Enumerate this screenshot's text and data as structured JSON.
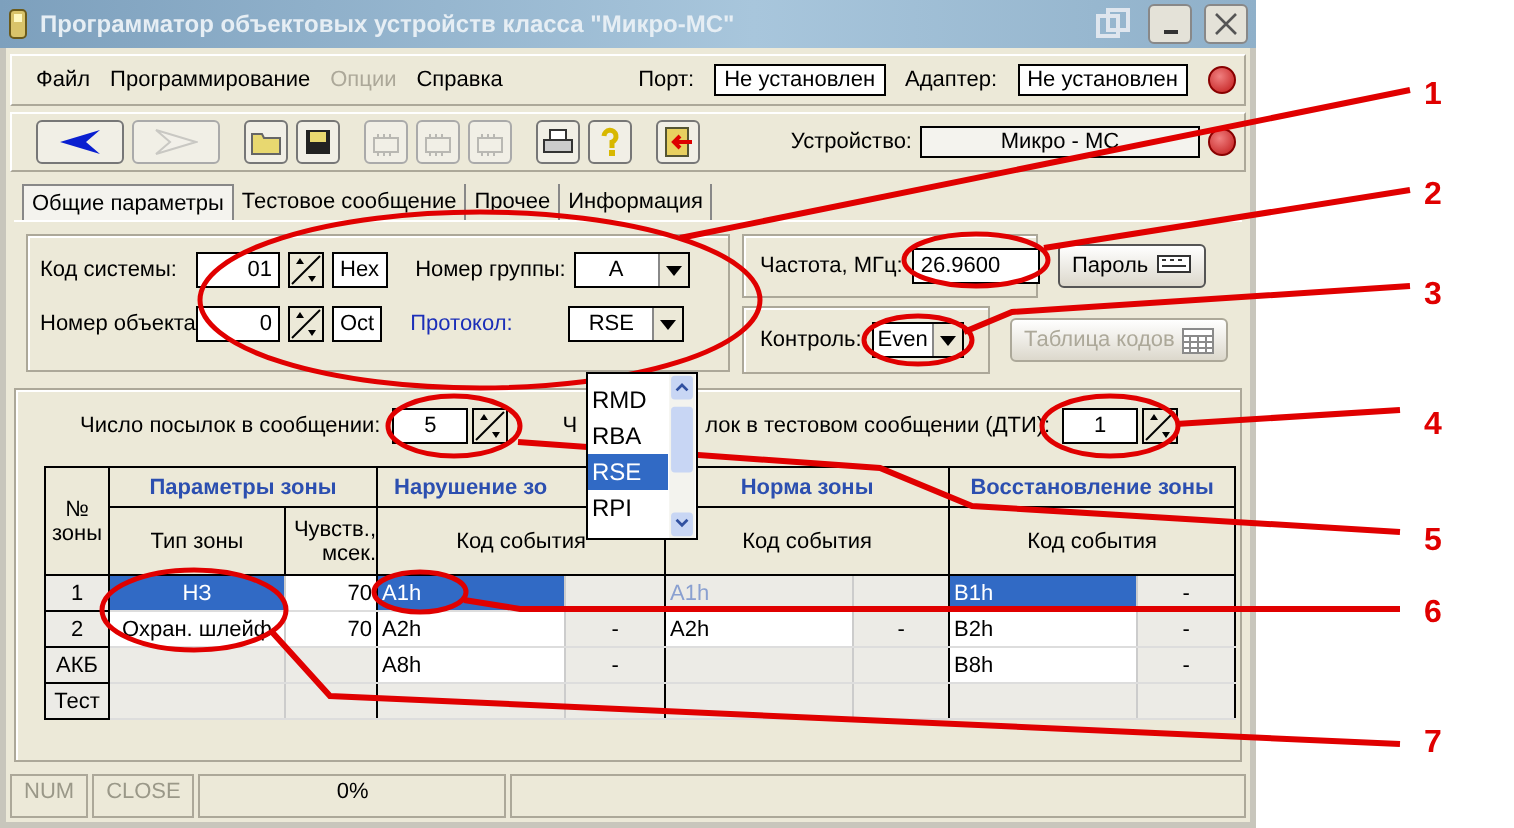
{
  "window": {
    "title": "Программатор объектовых устройств класса \"Микро-МС\""
  },
  "menu": [
    {
      "label": "Файл",
      "disabled": false
    },
    {
      "label": "Программирование",
      "disabled": false
    },
    {
      "label": "Опции",
      "disabled": true
    },
    {
      "label": "Справка",
      "disabled": false
    }
  ],
  "port": {
    "label": "Порт:",
    "value": "Не установлен"
  },
  "adapter": {
    "label": "Адаптер:",
    "value": "Не установлен"
  },
  "toolbar": [
    {
      "kind": "back",
      "disabled": false
    },
    {
      "kind": "forward",
      "disabled": true
    },
    {
      "kind": "open",
      "disabled": false
    },
    {
      "kind": "save",
      "disabled": false
    },
    {
      "kind": "read",
      "disabled": true
    },
    {
      "kind": "write",
      "disabled": true
    },
    {
      "kind": "clear",
      "disabled": true
    },
    {
      "kind": "print",
      "disabled": false
    },
    {
      "kind": "help",
      "disabled": false
    },
    {
      "kind": "exit",
      "disabled": false
    }
  ],
  "device": {
    "label": "Устройство:",
    "value": "Микро - МС"
  },
  "tabs": [
    {
      "label": "Общие  параметры",
      "selected": true
    },
    {
      "label": "Тестовое сообщение",
      "selected": false
    },
    {
      "label": "Прочее",
      "selected": false
    },
    {
      "label": "Информация",
      "selected": false
    }
  ],
  "system_code": {
    "label": "Код системы:",
    "value": "01",
    "base": "Hex"
  },
  "object_number": {
    "label": "Номер объекта:",
    "value": "0",
    "base": "Oct"
  },
  "group_number": {
    "label": "Номер группы:",
    "value": "A"
  },
  "protocol": {
    "label": "Протокол:",
    "value": "RSE",
    "options": [
      {
        "label": "RMD",
        "selected": false
      },
      {
        "label": "RBA",
        "selected": false
      },
      {
        "label": "RSE",
        "selected": true
      },
      {
        "label": "RPI",
        "selected": false
      }
    ]
  },
  "frequency": {
    "label": "Частота, МГц:",
    "value": "26.9600"
  },
  "password_button": "Пароль",
  "control": {
    "label": "Контроль:",
    "value": "Even"
  },
  "code_table_button": {
    "label": "Таблица кодов",
    "disabled": true
  },
  "packets": {
    "label": "Число посылок в сообщении:",
    "value": "5"
  },
  "test_packets": {
    "label_parts": [
      "Ч",
      "лок в тестовом сообщении (ДТИ):"
    ],
    "value": "1"
  },
  "table": {
    "group_headers": [
      "Параметры зоны",
      "Нарушение  зо",
      "Норма зоны",
      "Восстановление зоны"
    ],
    "number_header": "№ зоны",
    "columns": [
      "Тип зоны",
      "Чувств., мсек.",
      "Код события",
      "Код события",
      "Код события"
    ],
    "rows": [
      {
        "number": "1",
        "type": "НЗ",
        "sensitivity": "70",
        "violation": "A1h",
        "violation_mark": "",
        "norm": "A1h",
        "norm_mark": "",
        "restore": "B1h",
        "restore_mark": "-",
        "selected": true
      },
      {
        "number": "2",
        "type": "Охран. шлейф",
        "sensitivity": "70",
        "violation": "A2h",
        "violation_mark": "-",
        "norm": "A2h",
        "norm_mark": "-",
        "restore": "B2h",
        "restore_mark": "-",
        "selected": false
      },
      {
        "number": "АКБ",
        "type": "",
        "sensitivity": "",
        "violation": "A8h",
        "violation_mark": "-",
        "norm": "",
        "norm_mark": "",
        "restore": "B8h",
        "restore_mark": "-",
        "selected": false
      },
      {
        "number": "Тест",
        "type": "",
        "sensitivity": "",
        "violation": "",
        "violation_mark": "",
        "norm": "",
        "norm_mark": "",
        "restore": "",
        "restore_mark": "",
        "selected": false
      }
    ]
  },
  "status_bar": [
    {
      "text": "NUM",
      "disabled": true
    },
    {
      "text": "CLOSE",
      "disabled": true
    },
    {
      "text": "0%",
      "disabled": false
    }
  ],
  "callouts": [
    "1",
    "2",
    "3",
    "4",
    "5",
    "6",
    "7"
  ]
}
